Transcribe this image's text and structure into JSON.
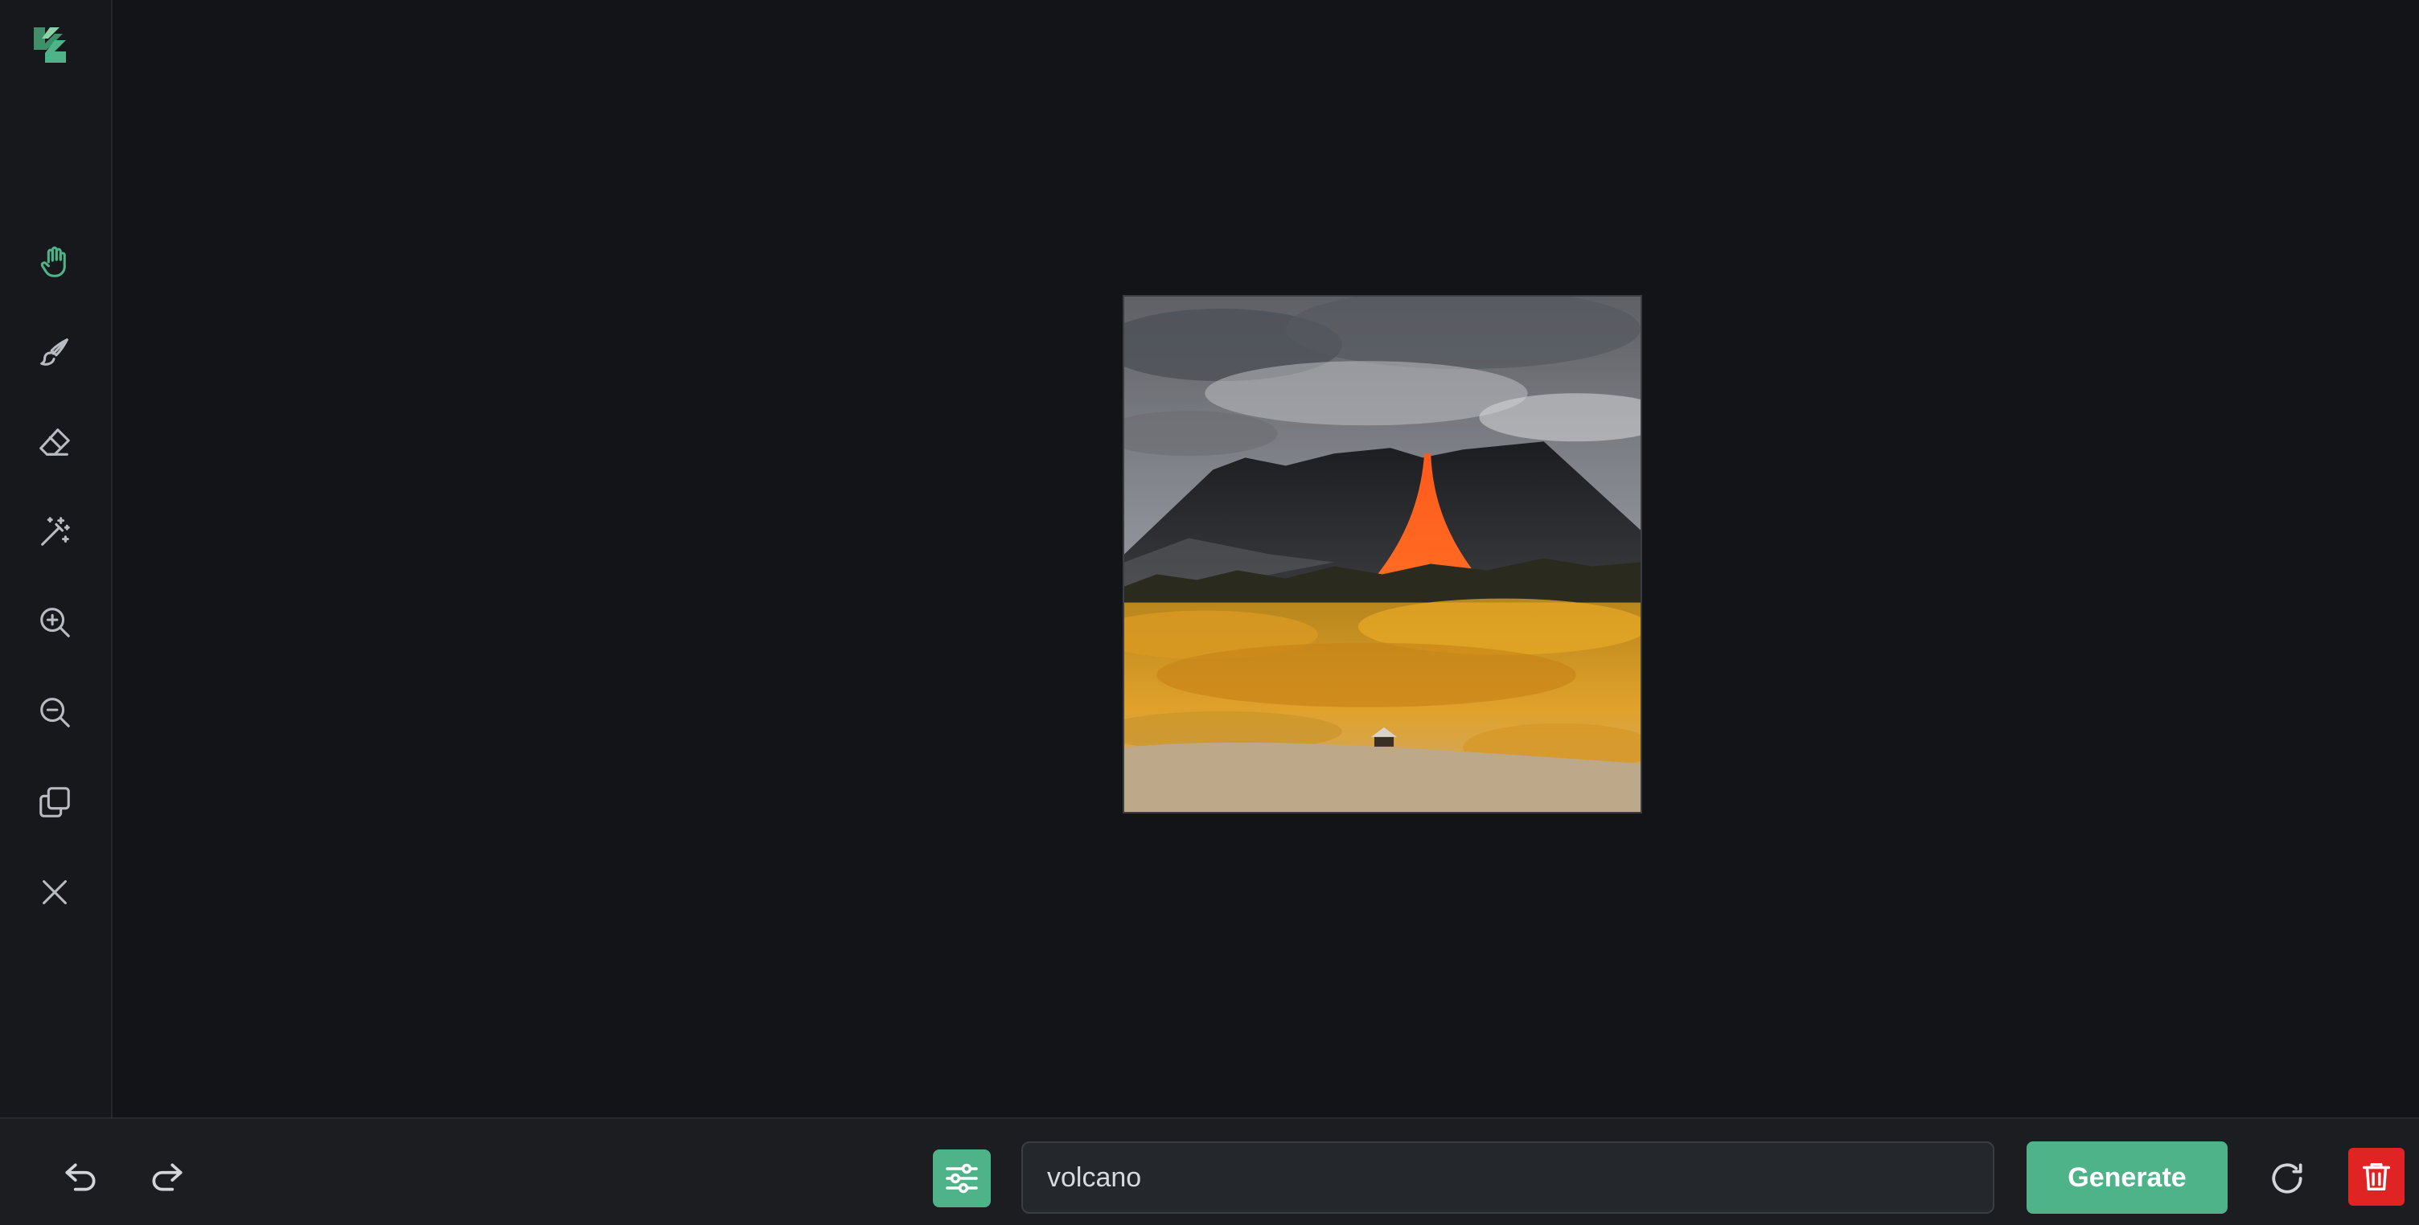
{
  "brand": {
    "logo_icon": "brand-logo-icon",
    "accent": "#4fb38a"
  },
  "toolbar": {
    "tools": [
      {
        "name": "hand-tool",
        "icon": "hand-icon",
        "active": true
      },
      {
        "name": "brush-tool",
        "icon": "brush-icon",
        "active": false
      },
      {
        "name": "eraser-tool",
        "icon": "eraser-icon",
        "active": false
      },
      {
        "name": "magic-wand-tool",
        "icon": "magic-wand-icon",
        "active": false
      },
      {
        "name": "zoom-in-tool",
        "icon": "zoom-in-icon",
        "active": false
      },
      {
        "name": "zoom-out-tool",
        "icon": "zoom-out-icon",
        "active": false
      },
      {
        "name": "duplicate-tool",
        "icon": "copy-icon",
        "active": false
      },
      {
        "name": "close-tool",
        "icon": "close-icon",
        "active": false
      }
    ]
  },
  "canvas": {
    "image_subject": "volcano-with-lava-over-autumn-forest"
  },
  "bottombar": {
    "undo_icon": "undo-icon",
    "redo_icon": "redo-icon",
    "settings_icon": "sliders-icon",
    "prompt_value": "volcano",
    "generate_label": "Generate",
    "refresh_icon": "refresh-icon",
    "delete_icon": "trash-icon",
    "delete_color": "#e02424"
  }
}
